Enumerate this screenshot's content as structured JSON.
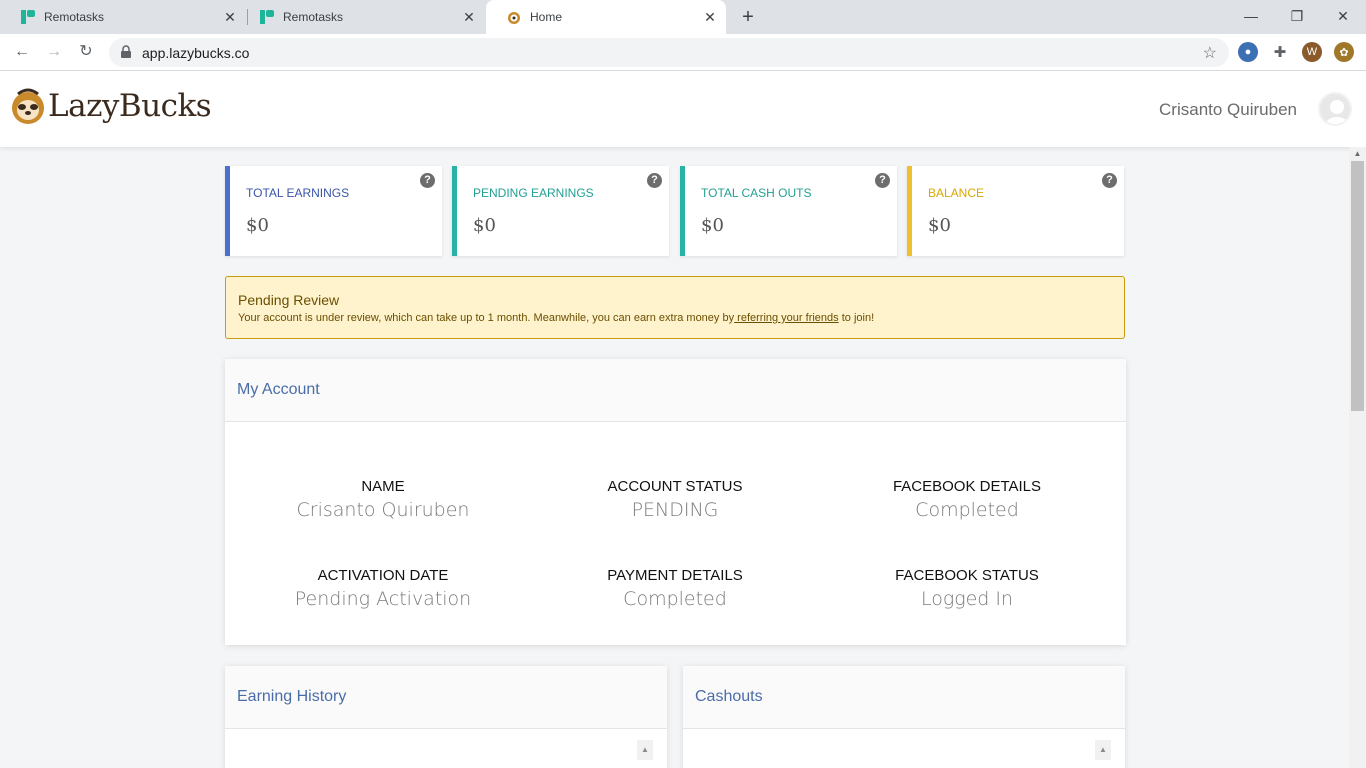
{
  "browser": {
    "tabs": [
      {
        "title": "Remotasks",
        "favicon": "remotasks-icon"
      },
      {
        "title": "Remotasks",
        "favicon": "remotasks-icon"
      },
      {
        "title": "Home",
        "favicon": "lazybucks-icon"
      }
    ],
    "new_tab_label": "+",
    "url": "app.lazybucks.co"
  },
  "header": {
    "logo_text": "LazyBucks",
    "user_name": "Crisanto Quiruben"
  },
  "stats": [
    {
      "label": "TOTAL EARNINGS",
      "value": "$0",
      "color": "#4a6fd1"
    },
    {
      "label": "PENDING EARNINGS",
      "value": "$0",
      "color": "#29b3a6"
    },
    {
      "label": "TOTAL CASH OUTS",
      "value": "$0",
      "color": "#29b3a6"
    },
    {
      "label": "BALANCE",
      "value": "$0",
      "color": "#f0c030"
    }
  ],
  "help_glyph": "?",
  "alert": {
    "title": "Pending Review",
    "message_before": "Your account is under review, which can take up to 1 month. Meanwhile, you can earn extra money by",
    "link_text": " referring your friends",
    "message_after": " to join!"
  },
  "account": {
    "title": "My Account",
    "fields": [
      {
        "label": "NAME",
        "value": "Crisanto Quiruben"
      },
      {
        "label": "ACCOUNT STATUS",
        "value": "PENDING"
      },
      {
        "label": "FACEBOOK DETAILS",
        "value": "Completed"
      },
      {
        "label": "ACTIVATION DATE",
        "value": "Pending Activation"
      },
      {
        "label": "PAYMENT DETAILS",
        "value": "Completed"
      },
      {
        "label": "FACEBOOK STATUS",
        "value": "Logged In"
      }
    ]
  },
  "earning_history": {
    "title": "Earning History"
  },
  "cashouts": {
    "title": "Cashouts"
  }
}
